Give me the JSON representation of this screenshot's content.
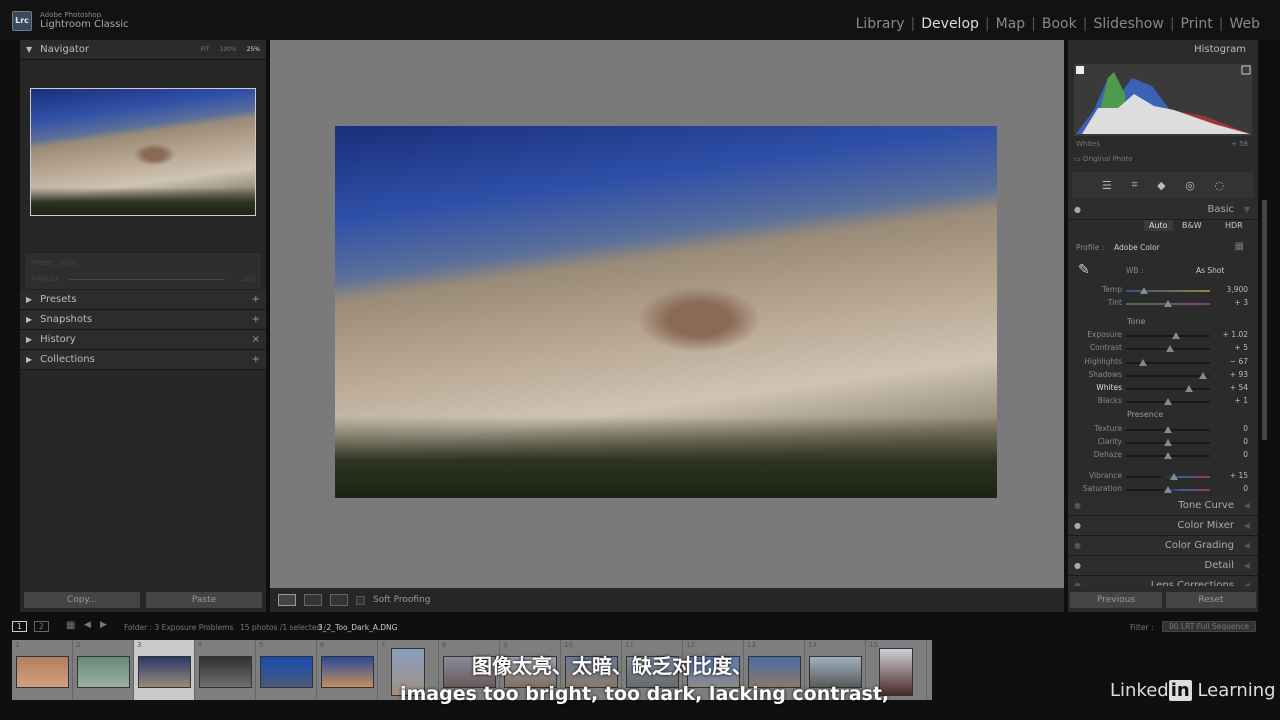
{
  "app": {
    "logo": "Lrc",
    "brand_line1": "Adobe Photoshop",
    "brand_line2": "Lightroom Classic"
  },
  "modules": [
    "Library",
    "Develop",
    "Map",
    "Book",
    "Slideshow",
    "Print",
    "Web"
  ],
  "active_module": "Develop",
  "navigator": {
    "title": "Navigator",
    "zoom_fit": "FIT",
    "zoom_100": "100%",
    "zoom_25": "25%",
    "preset": "Preset : None",
    "amount_label": "Amount",
    "amount_value": "100"
  },
  "left_panels": [
    "Presets",
    "Snapshots",
    "History",
    "Collections"
  ],
  "left_buttons": {
    "copy": "Copy...",
    "paste": "Paste"
  },
  "toolbar": {
    "soft_proofing": "Soft Proofing"
  },
  "histogram": {
    "title": "Histogram",
    "readout_label": "Whites",
    "readout_value": "+ 58",
    "original_photo": "Original Photo"
  },
  "basic": {
    "title": "Basic",
    "auto": "Auto",
    "bw": "B&W",
    "hdr": "HDR",
    "profile_label": "Profile :",
    "profile_value": "Adobe Color",
    "wb_label": "WB :",
    "wb_value": "As Shot",
    "tone_label": "Tone",
    "presence_label": "Presence",
    "sliders": [
      {
        "label": "Temp",
        "value": "3,900",
        "pos": 0.22
      },
      {
        "label": "Tint",
        "value": "+ 3",
        "pos": 0.5
      },
      {
        "label": "Exposure",
        "value": "+ 1.02",
        "pos": 0.6
      },
      {
        "label": "Contrast",
        "value": "+ 5",
        "pos": 0.52
      },
      {
        "label": "Highlights",
        "value": "− 67",
        "pos": 0.2
      },
      {
        "label": "Shadows",
        "value": "+ 93",
        "pos": 0.92
      },
      {
        "label": "Whites",
        "value": "+ 54",
        "pos": 0.75
      },
      {
        "label": "Blacks",
        "value": "+ 1",
        "pos": 0.5
      },
      {
        "label": "Texture",
        "value": "0",
        "pos": 0.5
      },
      {
        "label": "Clarity",
        "value": "0",
        "pos": 0.5
      },
      {
        "label": "Dehaze",
        "value": "0",
        "pos": 0.5
      },
      {
        "label": "Vibrance",
        "value": "+ 15",
        "pos": 0.57
      },
      {
        "label": "Saturation",
        "value": "0",
        "pos": 0.5
      }
    ]
  },
  "right_panels": [
    "Tone Curve",
    "Color Mixer",
    "Color Grading",
    "Detail",
    "Lens Corrections"
  ],
  "right_buttons": {
    "previous": "Previous",
    "reset": "Reset"
  },
  "filmstrip": {
    "view1": "1",
    "view2": "2",
    "folder": "Folder : 3 Exposure Problems",
    "count": "15 photos /1 selected /",
    "filename": "3_2_Too_Dark_A.DNG",
    "filter_label": "Filter :",
    "filter_value": "00 LRT Full Sequence",
    "numbers": [
      "1",
      "2",
      "3",
      "4",
      "5",
      "6",
      "7",
      "8",
      "9",
      "10",
      "11",
      "12",
      "13",
      "14",
      "15"
    ],
    "selected": 3
  },
  "subtitles": {
    "cn": "图像太亮、太暗、缺乏对比度、",
    "en": "images too bright, too dark, lacking contrast,"
  },
  "watermark": {
    "linkedin": "Linked",
    "linkedin_in": "in",
    "learning": " Learning"
  }
}
